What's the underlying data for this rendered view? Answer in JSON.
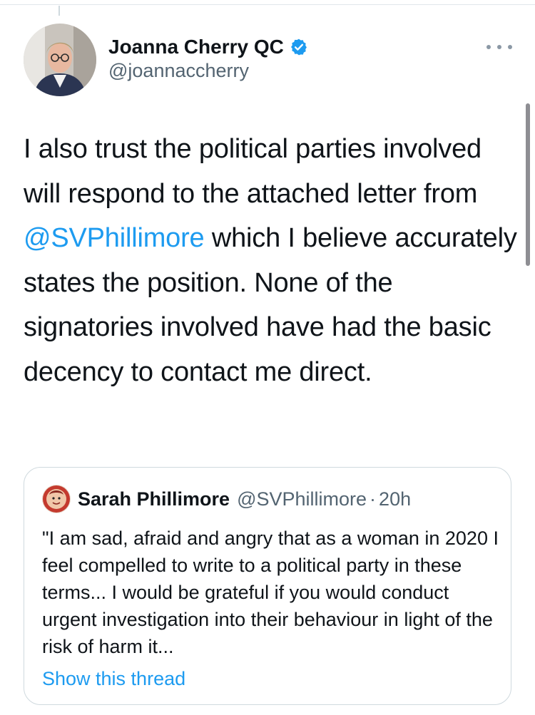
{
  "tweet": {
    "author_name": "Joanna Cherry QC",
    "author_handle": "@joannaccherry",
    "verified": true,
    "more_icon": "ellipsis-icon",
    "text_part1": "I also trust the political parties involved will respond to the attached letter from ",
    "mention": "@SVPhillimore",
    "text_part2": " which I believe accurately states the position. None of the signatories involved have had the basic decency to contact me direct."
  },
  "quote": {
    "author_name": "Sarah Phillimore",
    "author_handle": "@SVPhillimore",
    "separator": "·",
    "time": "20h",
    "text": "\"I am sad, afraid and angry that as a woman in 2020 I feel compelled to write to a political party in these terms... I would be grateful if you would conduct urgent investigation into their behaviour in light of the risk of harm it...",
    "show_thread": "Show this thread"
  },
  "colors": {
    "accent": "#1d9bf0",
    "text": "#0f1419",
    "secondary": "#536471",
    "border": "#cfd9de"
  }
}
